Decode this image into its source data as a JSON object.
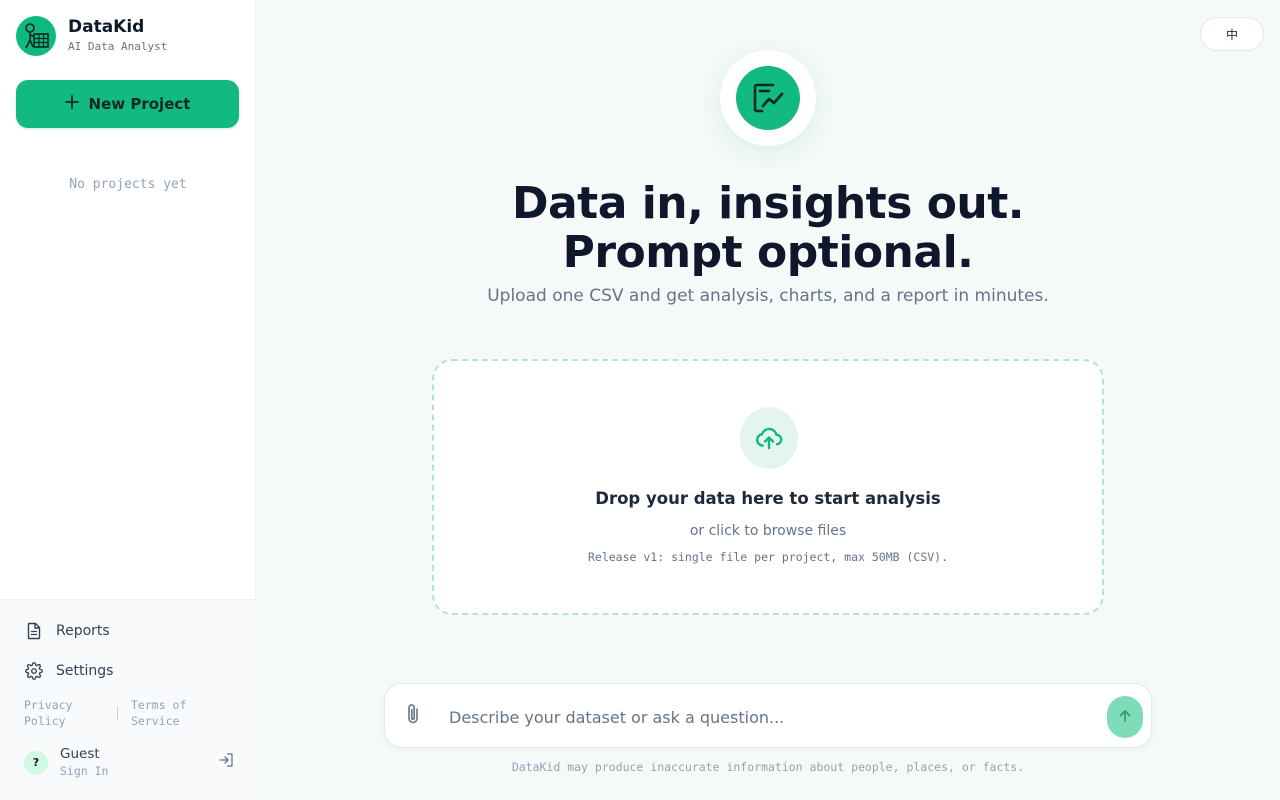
{
  "app": {
    "name": "DataKid",
    "tagline": "AI Data Analyst",
    "accent_color": "#12b981"
  },
  "sidebar": {
    "new_project_label": "New Project",
    "empty_projects_text": "No projects yet",
    "nav": [
      {
        "label": "Reports",
        "icon": "document-icon"
      },
      {
        "label": "Settings",
        "icon": "gear-icon"
      }
    ],
    "legal": {
      "privacy": "Privacy Policy",
      "terms": "Terms of Service"
    },
    "user": {
      "avatar_initial": "?",
      "name": "Guest",
      "action": "Sign In"
    }
  },
  "header": {
    "language_toggle": "中"
  },
  "hero": {
    "title_line1": "Data in, insights out.",
    "title_line2": "Prompt optional.",
    "subtitle": "Upload one CSV and get analysis, charts, and a report in minutes."
  },
  "dropzone": {
    "title": "Drop your data here to start analysis",
    "subtitle": "or click to browse files",
    "note": "Release v1: single file per project, max 50MB (CSV)."
  },
  "composer": {
    "placeholder": "Describe your dataset or ask a question...",
    "value": ""
  },
  "footer": {
    "disclaimer": "DataKid may produce inaccurate information about people, places, or facts."
  }
}
